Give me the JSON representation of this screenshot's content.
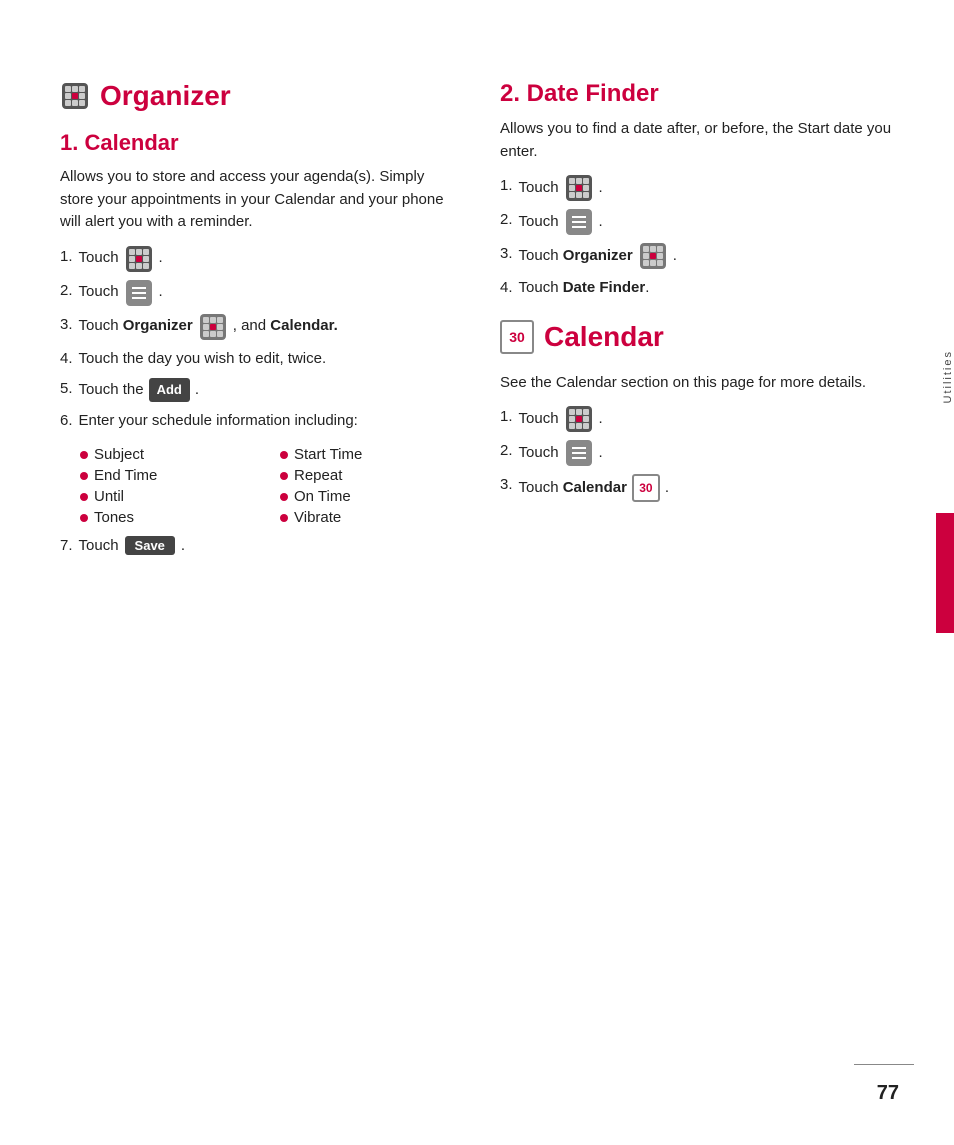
{
  "page": {
    "number": "77",
    "side_tab_label": "Utilities"
  },
  "left": {
    "main_title": "Organizer",
    "section1_title": "1. Calendar",
    "section1_desc": "Allows you to store and access your agenda(s). Simply store your appointments in your Calendar and your phone will alert you with a reminder.",
    "steps": [
      {
        "num": "1.",
        "text": "Touch",
        "icon": "apps-icon"
      },
      {
        "num": "2.",
        "text": "Touch",
        "icon": "menu-icon"
      },
      {
        "num": "3.",
        "text": "Touch",
        "bold": "Organizer",
        "icon": "organizer-icon",
        "extra": ", and",
        "bold2": "Calendar."
      },
      {
        "num": "4.",
        "text": "Touch the day you wish to edit, twice."
      },
      {
        "num": "5.",
        "text": "Touch the",
        "btn": "Add"
      },
      {
        "num": "6.",
        "text": "Enter your schedule information including:"
      }
    ],
    "bullet_items": [
      "Subject",
      "Start Time",
      "End Time",
      "Repeat",
      "Until",
      "On Time",
      "Tones",
      "Vibrate"
    ],
    "step7": {
      "num": "7.",
      "text": "Touch",
      "btn": "Save"
    }
  },
  "right": {
    "section2_title": "2. Date Finder",
    "section2_desc": "Allows you to find a date after, or before, the Start date you enter.",
    "date_finder_steps": [
      {
        "num": "1.",
        "text": "Touch",
        "icon": "apps-icon"
      },
      {
        "num": "2.",
        "text": "Touch",
        "icon": "menu-icon"
      },
      {
        "num": "3.",
        "text": "Touch",
        "bold": "Organizer",
        "icon": "organizer-icon"
      },
      {
        "num": "4.",
        "text": "Touch",
        "bold": "Date Finder"
      }
    ],
    "calendar_section_title": "Calendar",
    "calendar_section_desc": "See the Calendar section on this page for more details.",
    "calendar_steps": [
      {
        "num": "1.",
        "text": "Touch",
        "icon": "apps-icon"
      },
      {
        "num": "2.",
        "text": "Touch",
        "icon": "menu-icon"
      },
      {
        "num": "3.",
        "text": "Touch",
        "bold": "Calendar",
        "icon": "cal-icon"
      }
    ]
  }
}
